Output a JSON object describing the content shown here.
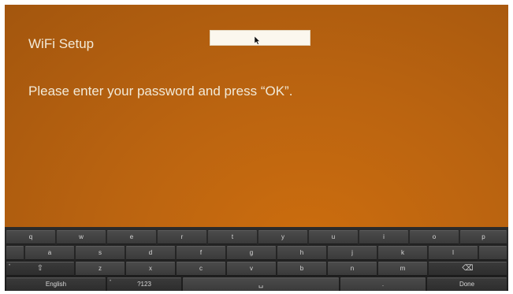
{
  "screen": {
    "title": "WiFi Setup",
    "prompt": "Please enter your password and press “OK”.",
    "password_value": ""
  },
  "keyboard": {
    "row1": [
      "q",
      "w",
      "e",
      "r",
      "t",
      "y",
      "u",
      "i",
      "o",
      "p"
    ],
    "row2": [
      "a",
      "s",
      "d",
      "f",
      "g",
      "h",
      "j",
      "k",
      "l"
    ],
    "row3": [
      "z",
      "x",
      "c",
      "v",
      "b",
      "n",
      "m"
    ],
    "shift_icon": "⇧",
    "backspace_icon": "⌫",
    "language": "English",
    "symbols": "?123",
    "space_icon": "␣",
    "period": ".",
    "done": "Done",
    "corner_mark": "•"
  },
  "colors": {
    "background": "#b8600f",
    "key": "#424242",
    "keyboard": "#222222"
  }
}
